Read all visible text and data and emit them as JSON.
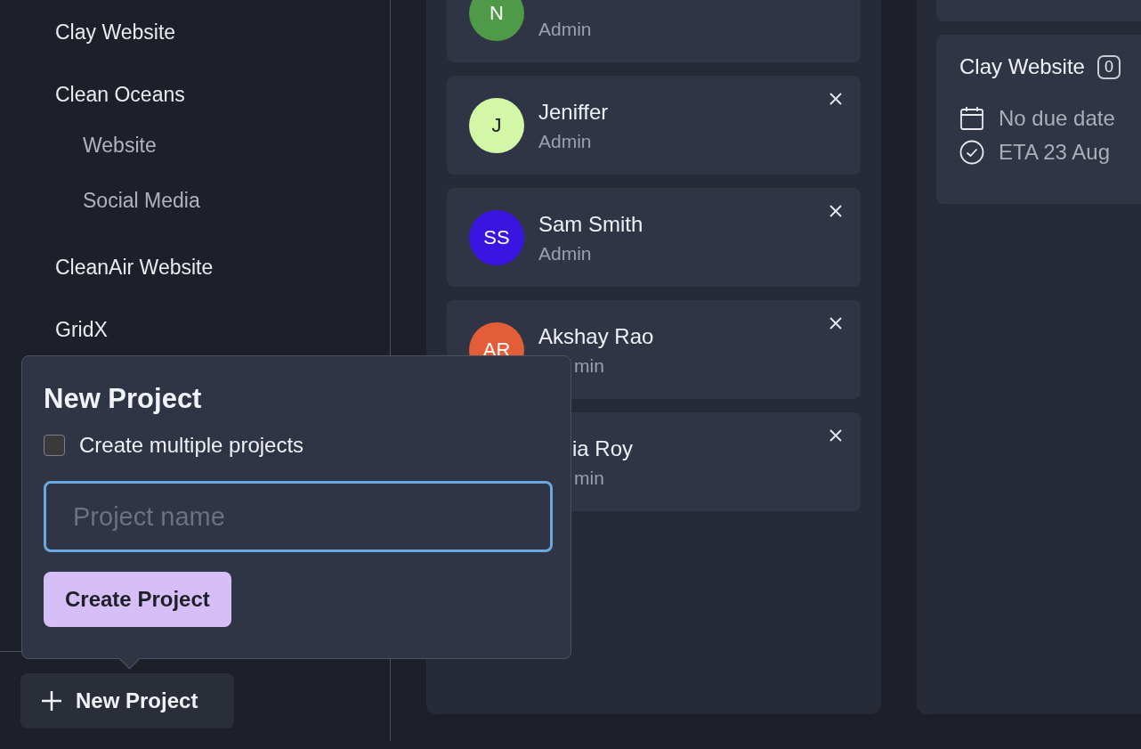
{
  "sidebar": {
    "projects": [
      {
        "label": "Clay Website"
      },
      {
        "label": "Clean Oceans",
        "children": [
          {
            "label": "Website"
          },
          {
            "label": "Social Media"
          }
        ]
      },
      {
        "label": "CleanAir Website"
      },
      {
        "label": "GridX"
      }
    ],
    "new_project_button": {
      "label": "New Project"
    }
  },
  "members": [
    {
      "kind": "plain",
      "initials": "N",
      "color": "#4e9a48",
      "role": "Admin"
    },
    {
      "kind": "plain",
      "initials": "J",
      "color": "#d2f7a6",
      "name": "Jeniffer",
      "role": "Admin"
    },
    {
      "kind": "plain",
      "initials": "SS",
      "color": "#3a14e0",
      "name": "Sam Smith",
      "role": "Admin"
    },
    {
      "kind": "role_covered",
      "initials": "AR",
      "color": "#e35d38",
      "name": "Akshay Rao",
      "role": "min"
    },
    {
      "kind": "covered",
      "name": "ia Roy",
      "role": "min"
    }
  ],
  "project_card": {
    "title": "Clay Website",
    "badge": "0",
    "due": "No due date",
    "eta": "ETA 23 Aug"
  },
  "popover": {
    "title": "New Project",
    "checkbox": {
      "label": "Create multiple projects",
      "checked": false
    },
    "input": {
      "placeholder": "Project name"
    },
    "submit": "Create Project"
  }
}
